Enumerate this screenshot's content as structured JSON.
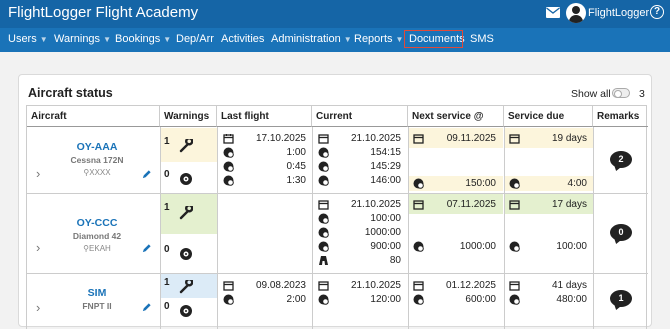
{
  "app": {
    "title": "FlightLogger Flight Academy",
    "user": "FlightLogger",
    "help": "?"
  },
  "nav": [
    {
      "label": "Users",
      "caret": true
    },
    {
      "label": "Warnings",
      "caret": true
    },
    {
      "label": "Bookings",
      "caret": true
    },
    {
      "label": "Dep/Arr",
      "caret": false
    },
    {
      "label": "Activities",
      "caret": false
    },
    {
      "label": "Administration",
      "caret": true
    },
    {
      "label": "Reports",
      "caret": true
    },
    {
      "label": "Documents",
      "caret": false,
      "highlighted": true
    },
    {
      "label": "SMS",
      "caret": false
    }
  ],
  "panel": {
    "title": "Aircraft status",
    "show_all_label": "Show all",
    "count": "3"
  },
  "columns": [
    "Aircraft",
    "Warnings",
    "Last flight",
    "Current",
    "Next service @",
    "Service due",
    "Remarks"
  ],
  "rows": [
    {
      "reg": "OY-AAA",
      "type": "Cessna 172N",
      "loc": "XXXX",
      "warn_top": "1",
      "warn_bottom": "0",
      "last": [
        "17.10.2025",
        "1:00",
        "0:45",
        "1:30"
      ],
      "current": [
        "21.10.2025",
        "154:15",
        "145:29",
        "146:00"
      ],
      "next_date": "09.11.2025",
      "next_hours": "150:00",
      "due_days": "19 days",
      "due_hours": "4:00",
      "remarks": "2"
    },
    {
      "reg": "OY-CCC",
      "type": "Diamond 42",
      "loc": "EKAH",
      "warn_top": "1",
      "warn_bottom": "0",
      "last": [],
      "current": [
        "21.10.2025",
        "100:00",
        "1000:00",
        "900:00",
        "80"
      ],
      "next_date": "07.11.2025",
      "next_hours": "1000:00",
      "due_days": "17 days",
      "due_hours": "100:00",
      "remarks": "0"
    },
    {
      "reg": "SIM",
      "type": "FNPT II",
      "loc": "",
      "warn_top": "1",
      "warn_bottom": "0",
      "last": [
        "09.08.2023",
        "2:00"
      ],
      "current": [
        "21.10.2025",
        "120:00"
      ],
      "next_date": "01.12.2025",
      "next_hours": "600:00",
      "due_days": "41 days",
      "due_hours": "480:00",
      "remarks": "1"
    }
  ],
  "colors": {
    "topbar": "#1565a6",
    "navbar": "#1a73b8",
    "link": "#1a73b8",
    "warn_yellow": "#fcf5dc",
    "warn_green": "#e4f0cf",
    "warn_blue": "#dcebf7",
    "nav_highlight": "#e04a3a"
  },
  "icons": {
    "mail": "envelope-icon",
    "avatar": "user-avatar-icon",
    "help": "help-icon",
    "wrench": "wrench-icon",
    "tire": "tire-icon",
    "calendar": "calendar-icon",
    "engine": "engine-clock-icon",
    "landing": "landing-icon",
    "pencil": "pencil-icon",
    "chevron": "chevron-right-icon",
    "remarks": "speech-bubble-icon",
    "location": "location-pin-icon"
  }
}
